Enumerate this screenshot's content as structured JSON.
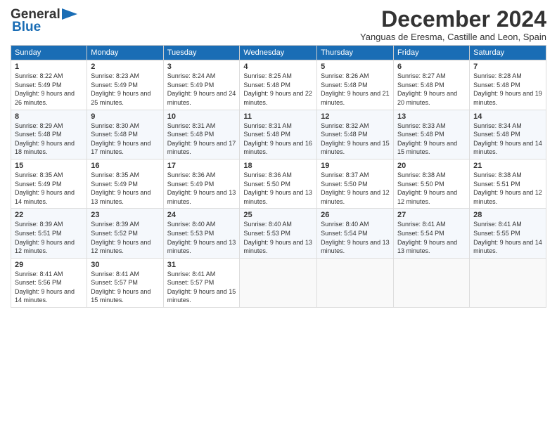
{
  "header": {
    "logo_general": "General",
    "logo_blue": "Blue",
    "month_title": "December 2024",
    "subtitle": "Yanguas de Eresma, Castille and Leon, Spain"
  },
  "days_of_week": [
    "Sunday",
    "Monday",
    "Tuesday",
    "Wednesday",
    "Thursday",
    "Friday",
    "Saturday"
  ],
  "weeks": [
    [
      {
        "day": 1,
        "sunrise": "Sunrise: 8:22 AM",
        "sunset": "Sunset: 5:49 PM",
        "daylight": "Daylight: 9 hours and 26 minutes."
      },
      {
        "day": 2,
        "sunrise": "Sunrise: 8:23 AM",
        "sunset": "Sunset: 5:49 PM",
        "daylight": "Daylight: 9 hours and 25 minutes."
      },
      {
        "day": 3,
        "sunrise": "Sunrise: 8:24 AM",
        "sunset": "Sunset: 5:49 PM",
        "daylight": "Daylight: 9 hours and 24 minutes."
      },
      {
        "day": 4,
        "sunrise": "Sunrise: 8:25 AM",
        "sunset": "Sunset: 5:48 PM",
        "daylight": "Daylight: 9 hours and 22 minutes."
      },
      {
        "day": 5,
        "sunrise": "Sunrise: 8:26 AM",
        "sunset": "Sunset: 5:48 PM",
        "daylight": "Daylight: 9 hours and 21 minutes."
      },
      {
        "day": 6,
        "sunrise": "Sunrise: 8:27 AM",
        "sunset": "Sunset: 5:48 PM",
        "daylight": "Daylight: 9 hours and 20 minutes."
      },
      {
        "day": 7,
        "sunrise": "Sunrise: 8:28 AM",
        "sunset": "Sunset: 5:48 PM",
        "daylight": "Daylight: 9 hours and 19 minutes."
      }
    ],
    [
      {
        "day": 8,
        "sunrise": "Sunrise: 8:29 AM",
        "sunset": "Sunset: 5:48 PM",
        "daylight": "Daylight: 9 hours and 18 minutes."
      },
      {
        "day": 9,
        "sunrise": "Sunrise: 8:30 AM",
        "sunset": "Sunset: 5:48 PM",
        "daylight": "Daylight: 9 hours and 17 minutes."
      },
      {
        "day": 10,
        "sunrise": "Sunrise: 8:31 AM",
        "sunset": "Sunset: 5:48 PM",
        "daylight": "Daylight: 9 hours and 17 minutes."
      },
      {
        "day": 11,
        "sunrise": "Sunrise: 8:31 AM",
        "sunset": "Sunset: 5:48 PM",
        "daylight": "Daylight: 9 hours and 16 minutes."
      },
      {
        "day": 12,
        "sunrise": "Sunrise: 8:32 AM",
        "sunset": "Sunset: 5:48 PM",
        "daylight": "Daylight: 9 hours and 15 minutes."
      },
      {
        "day": 13,
        "sunrise": "Sunrise: 8:33 AM",
        "sunset": "Sunset: 5:48 PM",
        "daylight": "Daylight: 9 hours and 15 minutes."
      },
      {
        "day": 14,
        "sunrise": "Sunrise: 8:34 AM",
        "sunset": "Sunset: 5:48 PM",
        "daylight": "Daylight: 9 hours and 14 minutes."
      }
    ],
    [
      {
        "day": 15,
        "sunrise": "Sunrise: 8:35 AM",
        "sunset": "Sunset: 5:49 PM",
        "daylight": "Daylight: 9 hours and 14 minutes."
      },
      {
        "day": 16,
        "sunrise": "Sunrise: 8:35 AM",
        "sunset": "Sunset: 5:49 PM",
        "daylight": "Daylight: 9 hours and 13 minutes."
      },
      {
        "day": 17,
        "sunrise": "Sunrise: 8:36 AM",
        "sunset": "Sunset: 5:49 PM",
        "daylight": "Daylight: 9 hours and 13 minutes."
      },
      {
        "day": 18,
        "sunrise": "Sunrise: 8:36 AM",
        "sunset": "Sunset: 5:50 PM",
        "daylight": "Daylight: 9 hours and 13 minutes."
      },
      {
        "day": 19,
        "sunrise": "Sunrise: 8:37 AM",
        "sunset": "Sunset: 5:50 PM",
        "daylight": "Daylight: 9 hours and 12 minutes."
      },
      {
        "day": 20,
        "sunrise": "Sunrise: 8:38 AM",
        "sunset": "Sunset: 5:50 PM",
        "daylight": "Daylight: 9 hours and 12 minutes."
      },
      {
        "day": 21,
        "sunrise": "Sunrise: 8:38 AM",
        "sunset": "Sunset: 5:51 PM",
        "daylight": "Daylight: 9 hours and 12 minutes."
      }
    ],
    [
      {
        "day": 22,
        "sunrise": "Sunrise: 8:39 AM",
        "sunset": "Sunset: 5:51 PM",
        "daylight": "Daylight: 9 hours and 12 minutes."
      },
      {
        "day": 23,
        "sunrise": "Sunrise: 8:39 AM",
        "sunset": "Sunset: 5:52 PM",
        "daylight": "Daylight: 9 hours and 12 minutes."
      },
      {
        "day": 24,
        "sunrise": "Sunrise: 8:40 AM",
        "sunset": "Sunset: 5:53 PM",
        "daylight": "Daylight: 9 hours and 13 minutes."
      },
      {
        "day": 25,
        "sunrise": "Sunrise: 8:40 AM",
        "sunset": "Sunset: 5:53 PM",
        "daylight": "Daylight: 9 hours and 13 minutes."
      },
      {
        "day": 26,
        "sunrise": "Sunrise: 8:40 AM",
        "sunset": "Sunset: 5:54 PM",
        "daylight": "Daylight: 9 hours and 13 minutes."
      },
      {
        "day": 27,
        "sunrise": "Sunrise: 8:41 AM",
        "sunset": "Sunset: 5:54 PM",
        "daylight": "Daylight: 9 hours and 13 minutes."
      },
      {
        "day": 28,
        "sunrise": "Sunrise: 8:41 AM",
        "sunset": "Sunset: 5:55 PM",
        "daylight": "Daylight: 9 hours and 14 minutes."
      }
    ],
    [
      {
        "day": 29,
        "sunrise": "Sunrise: 8:41 AM",
        "sunset": "Sunset: 5:56 PM",
        "daylight": "Daylight: 9 hours and 14 minutes."
      },
      {
        "day": 30,
        "sunrise": "Sunrise: 8:41 AM",
        "sunset": "Sunset: 5:57 PM",
        "daylight": "Daylight: 9 hours and 15 minutes."
      },
      {
        "day": 31,
        "sunrise": "Sunrise: 8:41 AM",
        "sunset": "Sunset: 5:57 PM",
        "daylight": "Daylight: 9 hours and 15 minutes."
      },
      null,
      null,
      null,
      null
    ]
  ]
}
